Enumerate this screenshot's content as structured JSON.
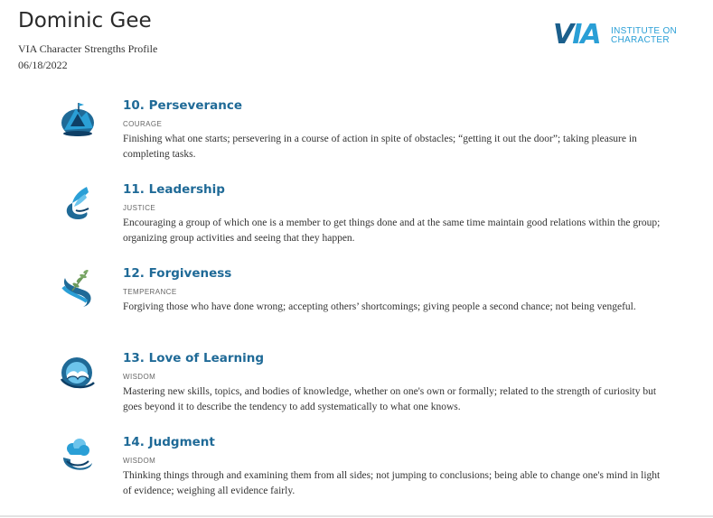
{
  "header": {
    "name": "Dominic Gee",
    "subtitle": "VIA Character Strengths Profile",
    "date": "06/18/2022"
  },
  "logo": {
    "mark_v": "V",
    "mark_ia": "IA",
    "line1": "INSTITUTE ON",
    "line2": "CHARACTER"
  },
  "strengths": [
    {
      "title": "10. Perseverance",
      "virtue": "COURAGE",
      "icon": "mountain-summit-icon",
      "description": "Finishing what one starts; persevering in a course of action in spite of obstacles; “getting it out the door”; taking pleasure in completing tasks."
    },
    {
      "title": "11. Leadership",
      "virtue": "JUSTICE",
      "icon": "wings-swirl-icon",
      "description": "Encouraging a group of which one is a member to get things done and at the same time maintain good relations within the group; organizing group activities and seeing that they happen."
    },
    {
      "title": "12. Forgiveness",
      "virtue": "TEMPERANCE",
      "icon": "olive-branch-icon",
      "description": "Forgiving those who have done wrong; accepting others’ shortcomings; giving people a second chance; not being vengeful."
    },
    {
      "title": "13. Love of Learning",
      "virtue": "WISDOM",
      "icon": "open-book-icon",
      "description": "Mastering new skills, topics, and bodies of knowledge, whether on one's own or formally; related to the strength of curiosity but goes beyond it to describe the tendency to add systematically to what one knows."
    },
    {
      "title": "14. Judgment",
      "virtue": "WISDOM",
      "icon": "cloud-swirl-icon",
      "description": "Thinking things through and examining them from all sides; not jumping to conclusions; being able to change one's mind in light of evidence; weighing all evidence fairly."
    }
  ]
}
